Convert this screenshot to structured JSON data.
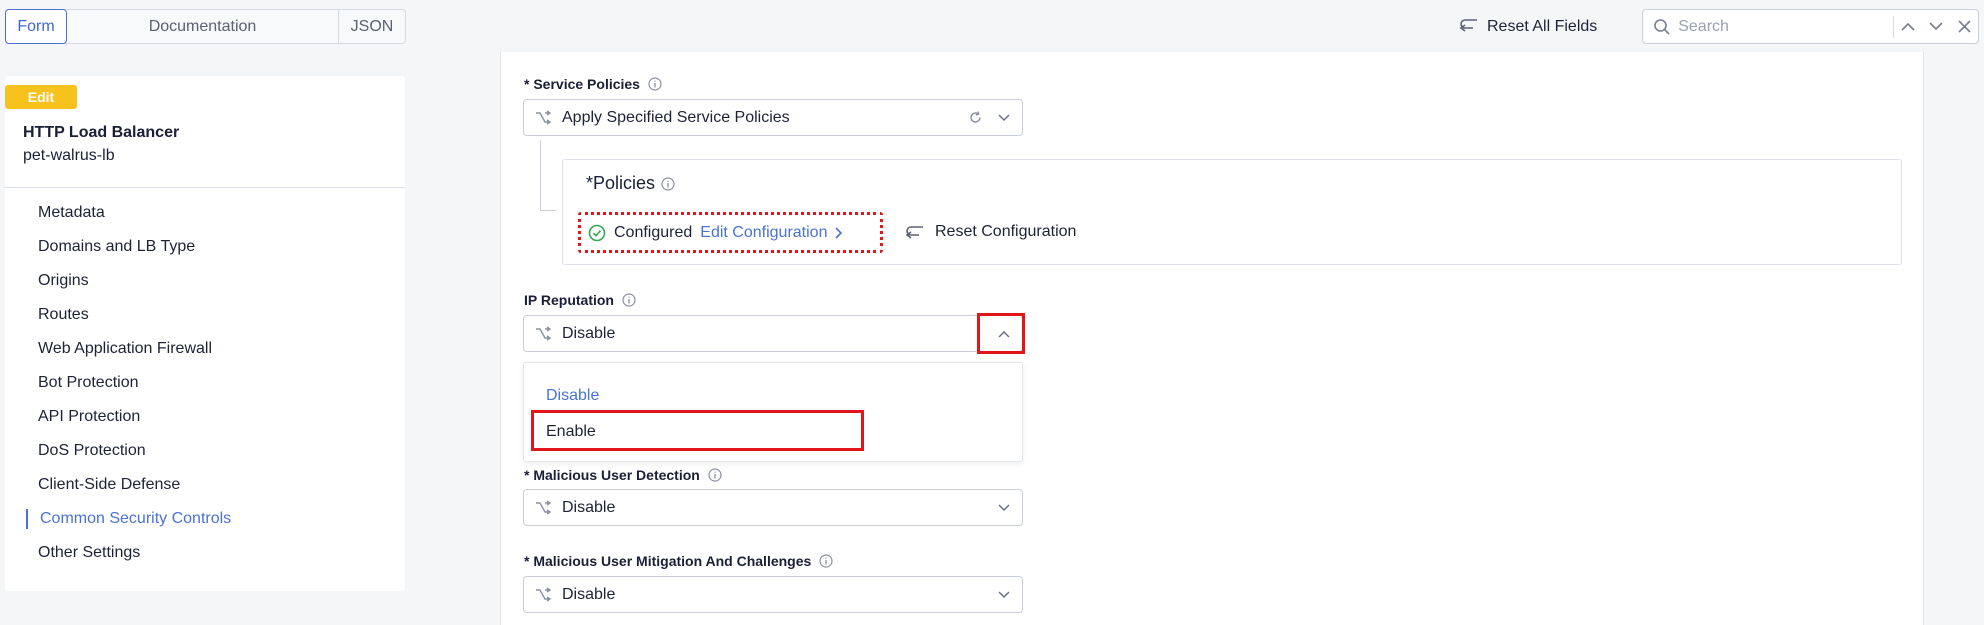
{
  "tabs": {
    "form": "Form",
    "documentation": "Documentation",
    "json": "JSON"
  },
  "toolbar": {
    "reset_all": "Reset All Fields",
    "search_placeholder": "Search"
  },
  "sidebar": {
    "badge": "Edit",
    "title": "HTTP Load Balancer",
    "name": "pet-walrus-lb",
    "items": [
      {
        "label": "Metadata"
      },
      {
        "label": "Domains and LB Type"
      },
      {
        "label": "Origins"
      },
      {
        "label": "Routes"
      },
      {
        "label": "Web Application Firewall"
      },
      {
        "label": "Bot Protection"
      },
      {
        "label": "API Protection"
      },
      {
        "label": "DoS Protection"
      },
      {
        "label": "Client-Side Defense"
      },
      {
        "label": "Common Security Controls",
        "active": true
      },
      {
        "label": "Other Settings"
      }
    ]
  },
  "form": {
    "service_policies": {
      "label": "* Service Policies",
      "value": "Apply Specified Service Policies"
    },
    "policies": {
      "title": "*Policies",
      "status": "Configured",
      "edit_link": "Edit Configuration",
      "reset": "Reset Configuration"
    },
    "ip_reputation": {
      "label": "IP Reputation",
      "value": "Disable",
      "options": [
        "Disable",
        "Enable"
      ]
    },
    "malicious_user_detection": {
      "label": "* Malicious User Detection",
      "value": "Disable"
    },
    "malicious_user_mitigation": {
      "label": "* Malicious User Mitigation And Challenges",
      "value": "Disable"
    }
  },
  "colors": {
    "accent": "#4a73d2",
    "badge": "#f7c21d",
    "highlight": "#e0161b",
    "success": "#2fa84f"
  }
}
